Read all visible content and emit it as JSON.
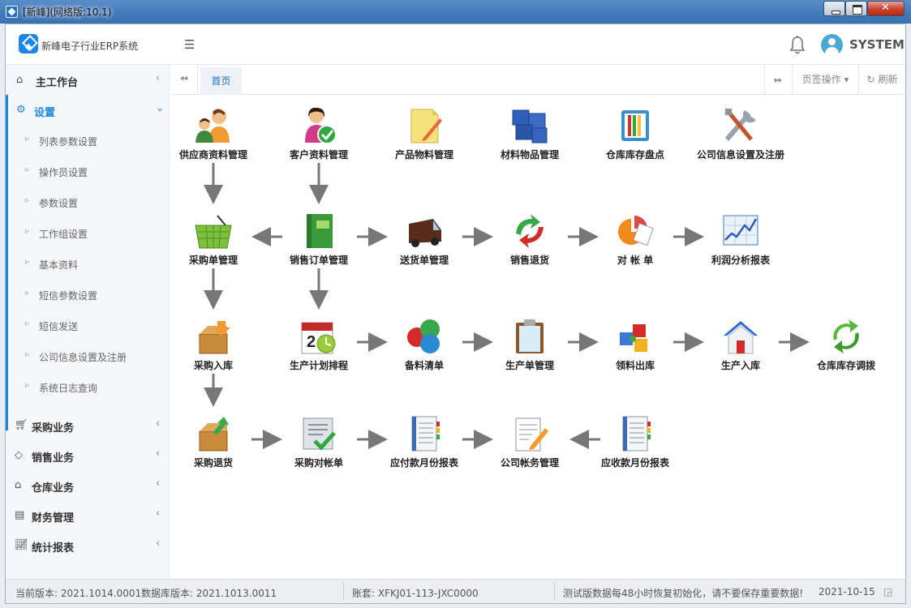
{
  "window": {
    "title": "[新峰](网络版:10.1)"
  },
  "header": {
    "app_name": "新峰电子行业ERP系统",
    "user": "SYSTEM"
  },
  "sidebar": {
    "workbench": "主工作台",
    "settings": "设置",
    "sub_items": [
      "列表参数设置",
      "操作员设置",
      "参数设置",
      "工作组设置",
      "基本资料",
      "短信参数设置",
      "短信发送",
      "公司信息设置及注册",
      "系统日志查询"
    ],
    "modules": [
      "采购业务",
      "销售业务",
      "仓库业务",
      "财务管理",
      "统计报表"
    ]
  },
  "tabs": {
    "home": "首页",
    "page_ops": "页签操作",
    "refresh": "刷新"
  },
  "flow": {
    "supplier": "供应商资料管理",
    "customer": "客户资料管理",
    "product": "产品物料管理",
    "material": "材料物品管理",
    "stocktake": "仓库库存盘点",
    "company_info": "公司信息设置及注册",
    "purchase_order": "采购单管理",
    "sales_order": "销售订单管理",
    "delivery": "送货单管理",
    "sales_return": "销售退货",
    "reconcile": "对 帐 单",
    "profit": "利润分析报表",
    "purchase_in": "采购入库",
    "production_plan": "生产计划排程",
    "bom": "备料清单",
    "production_order": "生产单管理",
    "material_out": "领料出库",
    "production_in": "生产入库",
    "transfer": "仓库库存调拨",
    "purchase_return": "采购退货",
    "purchase_reconcile": "采购对帐单",
    "payable": "应付款月份报表",
    "accounts": "公司帐务管理",
    "receivable": "应收款月份报表"
  },
  "status": {
    "version": "当前版本: 2021.1014.0001",
    "db_version": "数据库版本: 2021.1013.0011",
    "account": "账套: XFKJ01-113-JXC0000",
    "notice": "测试版数据每48小时恢复初始化，请不要保存重要数据!",
    "date": "2021-10-15"
  }
}
